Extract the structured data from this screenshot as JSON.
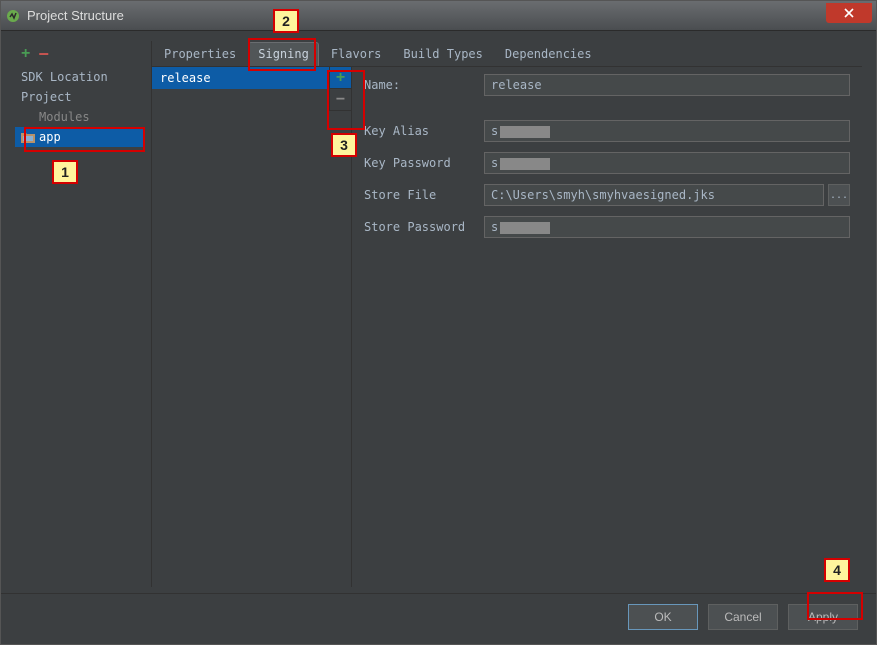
{
  "window": {
    "title": "Project Structure"
  },
  "sidebar": {
    "items": [
      {
        "label": "SDK Location"
      },
      {
        "label": "Project"
      },
      {
        "label": "Modules"
      },
      {
        "label": "app"
      }
    ]
  },
  "tabs": [
    {
      "label": "Properties"
    },
    {
      "label": "Signing"
    },
    {
      "label": "Flavors"
    },
    {
      "label": "Build Types"
    },
    {
      "label": "Dependencies"
    }
  ],
  "active_tab": "Signing",
  "configs": [
    {
      "name": "release"
    }
  ],
  "form": {
    "name_label": "Name:",
    "name_value": "release",
    "key_alias_label": "Key Alias",
    "key_alias_value": "s",
    "key_password_label": "Key Password",
    "key_password_value": "s",
    "store_file_label": "Store File",
    "store_file_value": "C:\\Users\\smyh\\smyhvaesigned.jks",
    "store_password_label": "Store Password",
    "store_password_value": "s"
  },
  "buttons": {
    "ok": "OK",
    "cancel": "Cancel",
    "apply": "Apply",
    "browse": "..."
  },
  "annotations": {
    "b1": "1",
    "b2": "2",
    "b3": "3",
    "b4": "4"
  }
}
